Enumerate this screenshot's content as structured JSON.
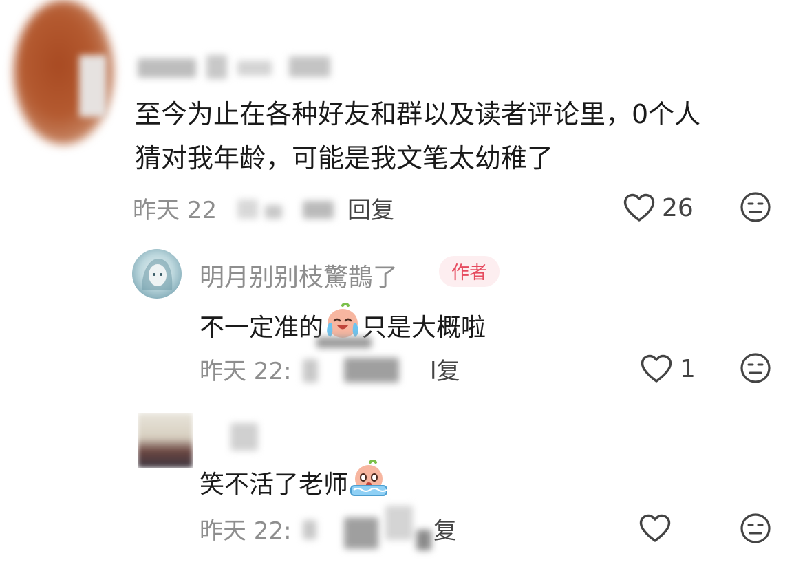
{
  "comments": [
    {
      "text_line1": "至今为止在各种好友和群以及读者评论里，0个人",
      "text_line2": "猜对我年龄，可能是我文笔太幼稚了",
      "time": "昨天 22",
      "reply_label": "回复",
      "likes": "26"
    }
  ],
  "replies": [
    {
      "username": "明月别别枝驚鵲了",
      "badge": "作者",
      "text_before": "不一定准的",
      "emoji": "crying-face-emoji",
      "text_after": "只是大概啦",
      "time": "昨天 22:",
      "reply_label": "l复",
      "likes": "1"
    },
    {
      "text": "笑不活了老师",
      "emoji": "crying-laughing-emoji",
      "time": "昨天 22:",
      "reply_label": "复"
    }
  ],
  "icons": {
    "like": "heart-outline-icon",
    "more": "neutral-face-icon"
  },
  "colors": {
    "text": "#1a1a1a",
    "meta": "#8e8e8e",
    "badge_bg": "#fdeef0",
    "badge_text": "#e64b5f"
  }
}
